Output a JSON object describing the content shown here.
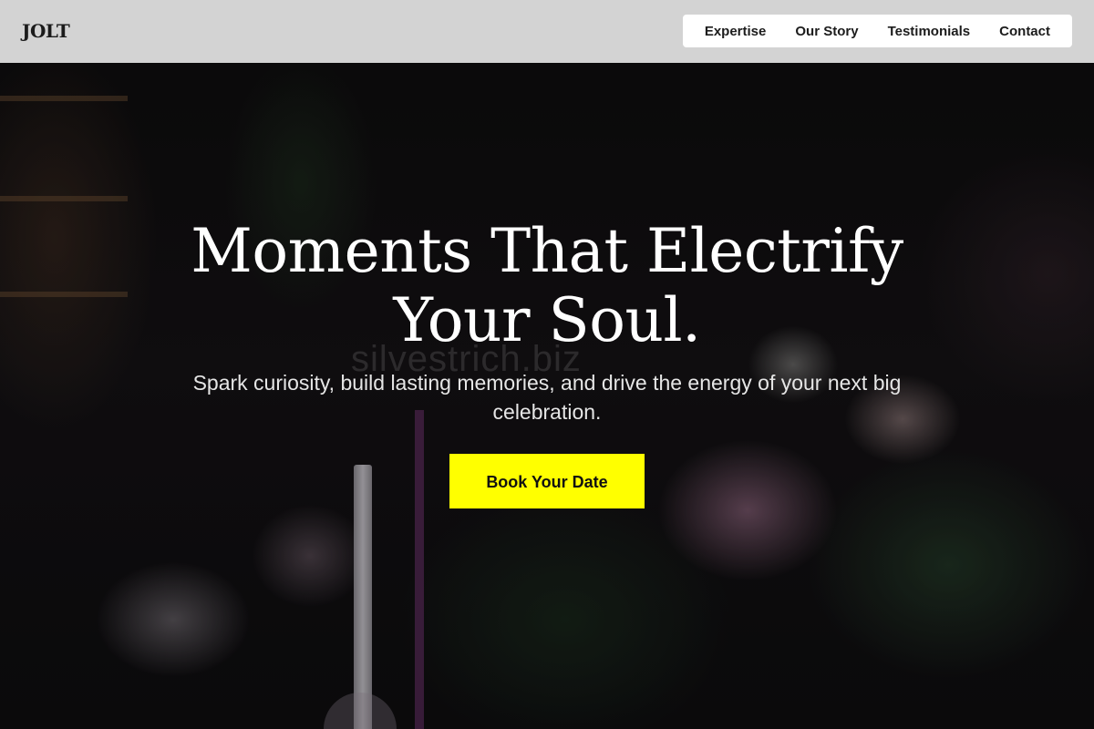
{
  "header": {
    "logo": "JOLT",
    "nav": [
      {
        "label": "Expertise"
      },
      {
        "label": "Our Story"
      },
      {
        "label": "Testimonials"
      },
      {
        "label": "Contact"
      }
    ]
  },
  "hero": {
    "title_line1": "Moments That Electrify",
    "title_line2": "Your Soul.",
    "subtitle": "Spark curiosity, build lasting memories, and drive the energy of your next big celebration.",
    "cta_label": "Book Your Date",
    "watermark": "silvestrich.biz"
  },
  "colors": {
    "header_bg": "#d3d3d3",
    "cta_bg": "#ffff00",
    "hero_text": "#ffffff"
  }
}
